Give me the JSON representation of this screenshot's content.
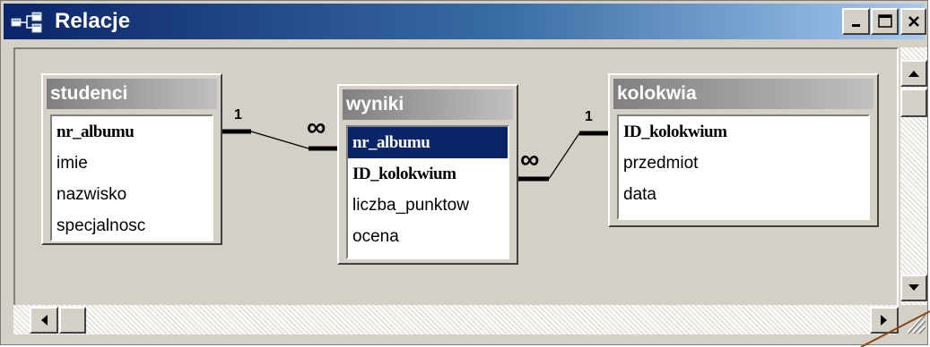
{
  "window": {
    "title": "Relacje"
  },
  "colors": {
    "titlebar_start": "#0a246a",
    "titlebar_end": "#a6caf0",
    "selected": "#0a246a",
    "annotation_line": "#8b4513"
  },
  "tables": {
    "studenci": {
      "title": "studenci",
      "fields": [
        {
          "name": "nr_albumu",
          "key": true
        },
        {
          "name": "imie",
          "key": false
        },
        {
          "name": "nazwisko",
          "key": false
        },
        {
          "name": "specjalnosc",
          "key": false
        }
      ]
    },
    "wyniki": {
      "title": "wyniki",
      "fields": [
        {
          "name": "nr_albumu",
          "key": true,
          "selected": true
        },
        {
          "name": "ID_kolokwium",
          "key": true
        },
        {
          "name": "liczba_punktow",
          "key": false
        },
        {
          "name": "ocena",
          "key": false
        }
      ]
    },
    "kolokwia": {
      "title": "kolokwia",
      "fields": [
        {
          "name": "ID_kolokwium",
          "key": true
        },
        {
          "name": "przedmiot",
          "key": false
        },
        {
          "name": "data",
          "key": false
        }
      ]
    }
  },
  "relationships": [
    {
      "from": "studenci.nr_albumu",
      "to": "wyniki.nr_albumu",
      "one_label": "1",
      "many_label": "∞"
    },
    {
      "from": "kolokwia.ID_kolokwium",
      "to": "wyniki.ID_kolokwium",
      "one_label": "1",
      "many_label": "∞"
    }
  ],
  "icons": {
    "app": "relationships-icon",
    "minimize": "minimize-icon",
    "maximize": "maximize-icon",
    "close": "close-icon"
  }
}
